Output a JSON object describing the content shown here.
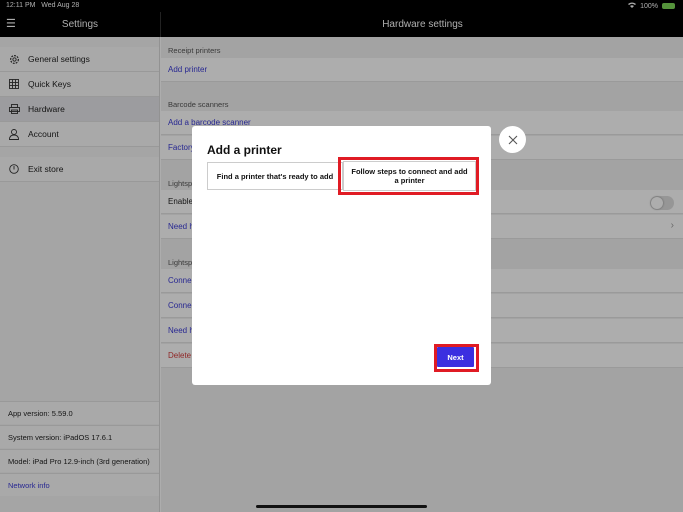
{
  "status_bar": {
    "time": "12:11 PM",
    "date": "Wed Aug 28",
    "battery": "100%"
  },
  "sidebar": {
    "title": "Settings",
    "items": [
      {
        "label": "General settings",
        "icon": "gear-icon"
      },
      {
        "label": "Quick Keys",
        "icon": "grid-icon"
      },
      {
        "label": "Hardware",
        "icon": "printer-icon",
        "active": true
      },
      {
        "label": "Account",
        "icon": "user-icon"
      },
      {
        "label": "Exit store",
        "icon": "power-icon"
      }
    ],
    "app_version": "App version: 5.59.0",
    "system_version": "System version: iPadOS 17.6.1",
    "model": "Model: iPad Pro 12.9-inch (3rd generation)",
    "network_info": "Network info"
  },
  "main": {
    "title": "Hardware settings",
    "receipt_section": "Receipt printers",
    "add_printer": "Add printer",
    "barcode_section": "Barcode scanners",
    "add_scanner": "Add a barcode scanner",
    "factory_partial": "Factory",
    "lightspeed_section_1": "Lightsp",
    "enable_partial": "Enable",
    "need_partial_1": "Need h",
    "lightspeed_section_2": "Lightsp",
    "connect_partial_1": "Conne",
    "connect_partial_2": "Conne",
    "need_partial_2": "Need h",
    "delete_partial": "Delete"
  },
  "modal": {
    "title": "Add a printer",
    "option_find": "Find a printer that's ready to add",
    "option_follow": "Follow steps to connect and add a printer",
    "next_label": "Next",
    "close_icon": "close-icon"
  },
  "colors": {
    "accent": "#3b2fe0",
    "highlight": "#e01b24",
    "link": "#3a3ad6"
  }
}
